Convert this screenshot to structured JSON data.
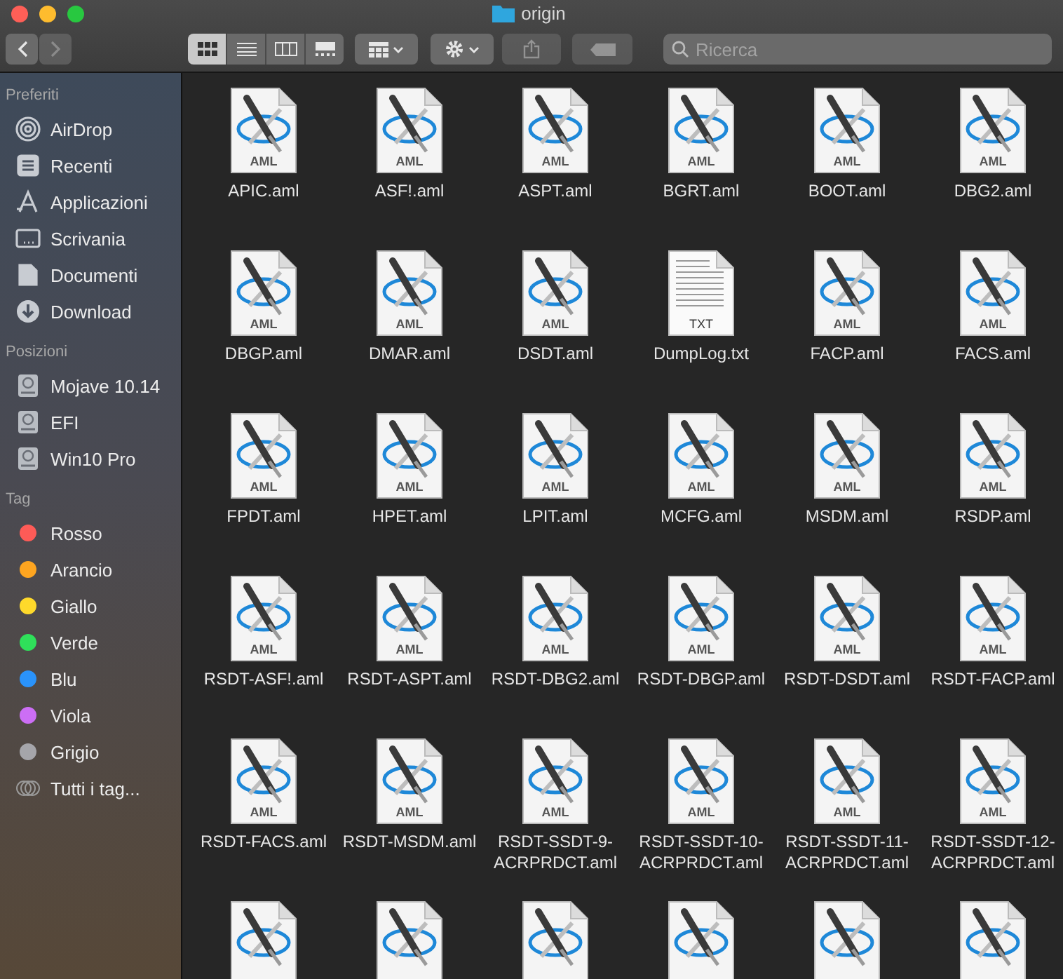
{
  "window": {
    "title": "origin"
  },
  "toolbar": {
    "view_modes": [
      {
        "kind": "icons",
        "selected": true
      },
      {
        "kind": "list",
        "selected": false
      },
      {
        "kind": "columns",
        "selected": false
      },
      {
        "kind": "gallery",
        "selected": false
      }
    ],
    "search": {
      "placeholder": "Ricerca"
    }
  },
  "sidebar": {
    "sections": [
      {
        "title": "Preferiti",
        "items": [
          {
            "kind": "airdrop",
            "label": "AirDrop"
          },
          {
            "kind": "recents",
            "label": "Recenti"
          },
          {
            "kind": "apps",
            "label": "Applicazioni"
          },
          {
            "kind": "desktop",
            "label": "Scrivania"
          },
          {
            "kind": "documents",
            "label": "Documenti"
          },
          {
            "kind": "downloads",
            "label": "Download"
          }
        ]
      },
      {
        "title": "Posizioni",
        "items": [
          {
            "kind": "disk",
            "label": "Mojave 10.14"
          },
          {
            "kind": "disk",
            "label": "EFI"
          },
          {
            "kind": "disk",
            "label": "Win10 Pro"
          }
        ]
      },
      {
        "title": "Tag",
        "items": [
          {
            "kind": "tag",
            "label": "Rosso",
            "color": "#fe5b57"
          },
          {
            "kind": "tag",
            "label": "Arancio",
            "color": "#fea520"
          },
          {
            "kind": "tag",
            "label": "Giallo",
            "color": "#fed92b"
          },
          {
            "kind": "tag",
            "label": "Verde",
            "color": "#2fe05a"
          },
          {
            "kind": "tag",
            "label": "Blu",
            "color": "#2a93fb"
          },
          {
            "kind": "tag",
            "label": "Viola",
            "color": "#cc6ef5"
          },
          {
            "kind": "tag",
            "label": "Grigio",
            "color": "#a5a5aa"
          },
          {
            "kind": "all-tags",
            "label": "Tutti i tag..."
          }
        ]
      }
    ]
  },
  "files": [
    {
      "kind": "aml",
      "badge": "AML",
      "name": "APIC.aml"
    },
    {
      "kind": "aml",
      "badge": "AML",
      "name": "ASF!.aml"
    },
    {
      "kind": "aml",
      "badge": "AML",
      "name": "ASPT.aml"
    },
    {
      "kind": "aml",
      "badge": "AML",
      "name": "BGRT.aml"
    },
    {
      "kind": "aml",
      "badge": "AML",
      "name": "BOOT.aml"
    },
    {
      "kind": "aml",
      "badge": "AML",
      "name": "DBG2.aml"
    },
    {
      "kind": "aml",
      "badge": "AML",
      "name": "DBGP.aml"
    },
    {
      "kind": "aml",
      "badge": "AML",
      "name": "DMAR.aml"
    },
    {
      "kind": "aml",
      "badge": "AML",
      "name": "DSDT.aml"
    },
    {
      "kind": "txt",
      "badge": "TXT",
      "name": "DumpLog.txt"
    },
    {
      "kind": "aml",
      "badge": "AML",
      "name": "FACP.aml"
    },
    {
      "kind": "aml",
      "badge": "AML",
      "name": "FACS.aml"
    },
    {
      "kind": "aml",
      "badge": "AML",
      "name": "FPDT.aml"
    },
    {
      "kind": "aml",
      "badge": "AML",
      "name": "HPET.aml"
    },
    {
      "kind": "aml",
      "badge": "AML",
      "name": "LPIT.aml"
    },
    {
      "kind": "aml",
      "badge": "AML",
      "name": "MCFG.aml"
    },
    {
      "kind": "aml",
      "badge": "AML",
      "name": "MSDM.aml"
    },
    {
      "kind": "aml",
      "badge": "AML",
      "name": "RSDP.aml"
    },
    {
      "kind": "aml",
      "badge": "AML",
      "name": "RSDT-ASF!.aml"
    },
    {
      "kind": "aml",
      "badge": "AML",
      "name": "RSDT-ASPT.aml"
    },
    {
      "kind": "aml",
      "badge": "AML",
      "name": "RSDT-DBG2.aml"
    },
    {
      "kind": "aml",
      "badge": "AML",
      "name": "RSDT-DBGP.aml"
    },
    {
      "kind": "aml",
      "badge": "AML",
      "name": "RSDT-DSDT.aml"
    },
    {
      "kind": "aml",
      "badge": "AML",
      "name": "RSDT-FACP.aml"
    },
    {
      "kind": "aml",
      "badge": "AML",
      "name": "RSDT-FACS.aml"
    },
    {
      "kind": "aml",
      "badge": "AML",
      "name": "RSDT-MSDM.aml"
    },
    {
      "kind": "aml",
      "badge": "AML",
      "name": "RSDT-SSDT-9-ACRPRDCT.aml"
    },
    {
      "kind": "aml",
      "badge": "AML",
      "name": "RSDT-SSDT-10-ACRPRDCT.aml"
    },
    {
      "kind": "aml",
      "badge": "AML",
      "name": "RSDT-SSDT-11-ACRPRDCT.aml"
    },
    {
      "kind": "aml",
      "badge": "AML",
      "name": "RSDT-SSDT-12-ACRPRDCT.aml"
    },
    {
      "kind": "aml"
    },
    {
      "kind": "aml"
    },
    {
      "kind": "aml"
    },
    {
      "kind": "aml"
    },
    {
      "kind": "aml"
    },
    {
      "kind": "aml"
    }
  ]
}
